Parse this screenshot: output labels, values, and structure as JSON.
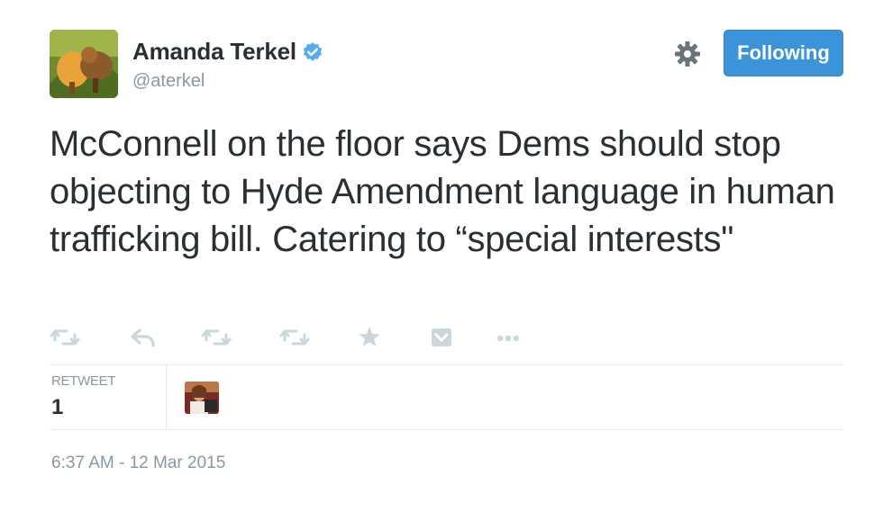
{
  "author": {
    "name": "Amanda Terkel",
    "handle": "@aterkel",
    "verified": true
  },
  "follow_button": {
    "label": "Following"
  },
  "tweet": {
    "text": "McConnell on the floor says Dems should stop objecting to Hyde Amendment language in human trafficking bill. Catering to “special interests\""
  },
  "actions": {
    "icons": [
      "retweet-icon",
      "reply-icon",
      "retweet-icon",
      "retweet-icon",
      "favorite-star-icon",
      "pocket-icon",
      "more-dots-icon"
    ]
  },
  "stats": {
    "label": "RETWEET",
    "count": "1"
  },
  "timestamp": "6:37 AM - 12 Mar 2015",
  "colors": {
    "accent": "#3b94d9",
    "text": "#292f33",
    "muted": "#8899a6",
    "icon": "#ccd6dd",
    "divider": "#e1e8ed"
  }
}
